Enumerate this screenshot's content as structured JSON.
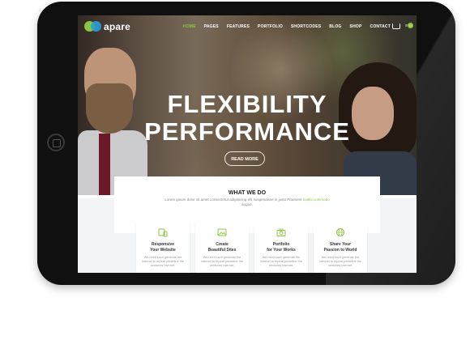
{
  "site": {
    "logo_text": "apare"
  },
  "nav": {
    "items": [
      "HOME",
      "PAGES",
      "FEATURES",
      "PORTFOLIO",
      "SHORTCODES",
      "BLOG",
      "SHOP",
      "CONTACT"
    ],
    "active": "HOME",
    "cart_count": "0"
  },
  "hero": {
    "line1": "FLEXIBILITY",
    "line2": "PERFORMANCE",
    "button_label": "READ MORE"
  },
  "what_we_do": {
    "title": "WHAT WE DO",
    "text": "Lorem ipsum dolor sit amet consectetur adipisicing elit suspendisse in justo Praesent",
    "link_text": "mattis commodo",
    "text_tail": "augue."
  },
  "features": [
    {
      "icon": "responsive-icon",
      "title_line1": "Responsive",
      "title_line2": "Your Website",
      "text": "We need such generate the internet to repeat predefine the centuries internet."
    },
    {
      "icon": "image-icon",
      "title_line1": "Create",
      "title_line2": "Beautiful Sites",
      "text": "We need such generate the internet to repeat predefine the centuries internet."
    },
    {
      "icon": "camera-icon",
      "title_line1": "Portfolio",
      "title_line2": "for Your Works",
      "text": "We need such generate the internet to repeat predefine the centuries internet."
    },
    {
      "icon": "globe-icon",
      "title_line1": "Share Your",
      "title_line2": "Passion to World",
      "text": "We need such generate the internet to repeat predefine the centuries internet."
    }
  ],
  "colors": {
    "accent": "#8cc63f",
    "logo_blue": "#2a9fd8",
    "device": "#101010"
  }
}
